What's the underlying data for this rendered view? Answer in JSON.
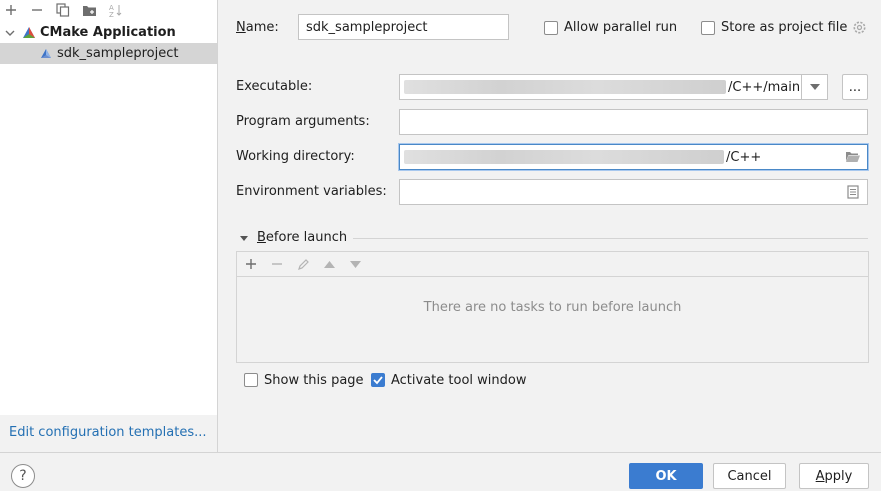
{
  "left_panel": {
    "tree": {
      "group": {
        "label": "CMake Application"
      },
      "item": {
        "label": "sdk_sampleproject"
      }
    },
    "footer_link": "Edit configuration templates..."
  },
  "form": {
    "name_label": "Name:",
    "name_value": "sdk_sampleproject",
    "allow_parallel_label": "Allow parallel run",
    "store_project_label": "Store as project file",
    "executable_label": "Executable:",
    "executable_value_suffix": "/C++/main",
    "executable_browse": "...",
    "program_args_label": "Program arguments:",
    "program_args_value": "",
    "working_dir_label": "Working directory:",
    "working_dir_value_suffix": "/C++",
    "env_vars_label": "Environment variables:",
    "env_vars_value": ""
  },
  "before_launch": {
    "title": "Before launch",
    "empty_text": "There are no tasks to run before launch"
  },
  "options": {
    "show_page_label": "Show this page",
    "activate_tool_label": "Activate tool window"
  },
  "buttons": {
    "ok": "OK",
    "cancel": "Cancel",
    "apply": "Apply",
    "help": "?"
  },
  "colors": {
    "accent": "#3b7cd0",
    "link": "#2470b3",
    "selection": "#d5d5d5"
  }
}
